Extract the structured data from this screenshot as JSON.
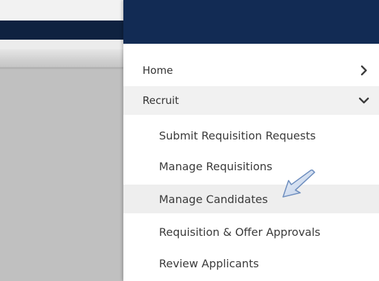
{
  "menu": {
    "items": [
      {
        "label": "Home",
        "icon": "chevron-right-icon"
      },
      {
        "label": "Recruit",
        "icon": "chevron-down-icon"
      }
    ],
    "recruit_subitems": [
      {
        "label": "Submit Requisition Requests"
      },
      {
        "label": "Manage Requisitions"
      },
      {
        "label": "Manage Candidates"
      },
      {
        "label": "Requisition & Offer Approvals"
      },
      {
        "label": "Review Applicants"
      }
    ]
  },
  "colors": {
    "header": "#122b54",
    "background_overlay": "#c0c0c0",
    "highlight": "#eeeeee"
  },
  "annotations": {
    "pointer_icon": "arrow-pointer-icon"
  }
}
